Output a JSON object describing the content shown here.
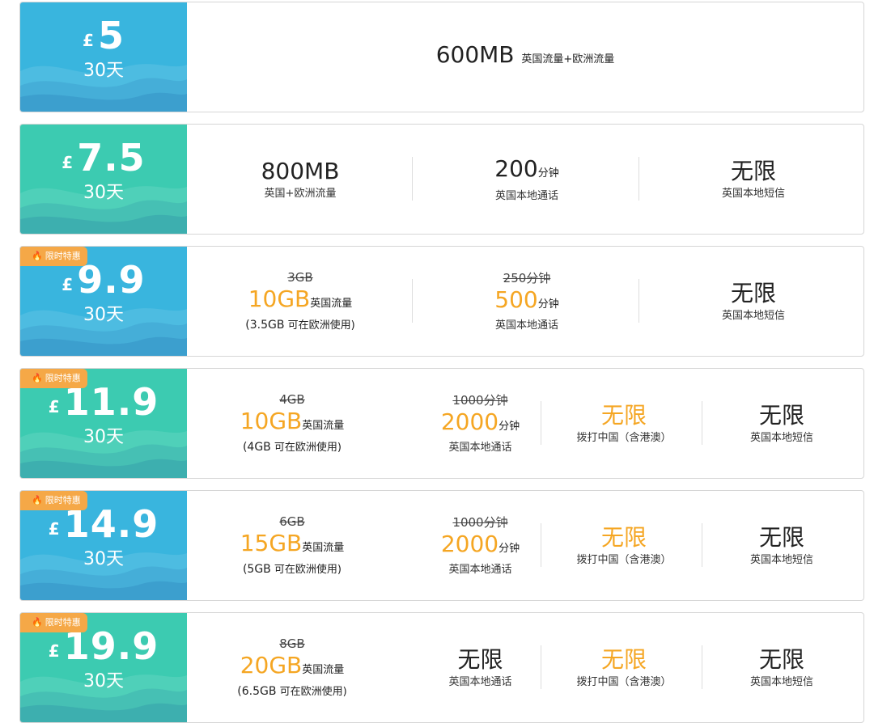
{
  "colors": {
    "blue": "#39b5de",
    "green": "#3ccbb1",
    "badge": "#f5a847",
    "highlight": "#f5a623"
  },
  "plans": [
    {
      "currency": "£",
      "amount": "5",
      "days": "30天",
      "badge": null,
      "data": {
        "value": "600MB",
        "desc": "英国流量+欧洲流量"
      }
    },
    {
      "currency": "£",
      "amount": "7.5",
      "days": "30天",
      "badge": null,
      "data": {
        "value": "800MB",
        "desc": "英国+欧洲流量"
      },
      "calls": {
        "value": "200",
        "unit": "分钟",
        "desc": "英国本地通话"
      },
      "sms": {
        "value": "无限",
        "desc": "英国本地短信"
      }
    },
    {
      "currency": "£",
      "amount": "9.9",
      "days": "30天",
      "badge": "限时特惠",
      "data": {
        "old": "3GB",
        "value": "10GB",
        "unit": "英国流量",
        "note_value": "(3.5GB",
        "note_text": " 可在欧洲使用)"
      },
      "calls": {
        "old": "250分钟",
        "value": "500",
        "unit": "分钟",
        "desc": "英国本地通话"
      },
      "sms": {
        "value": "无限",
        "desc": "英国本地短信"
      }
    },
    {
      "currency": "£",
      "amount": "11.9",
      "days": "30天",
      "badge": "限时特惠",
      "data": {
        "old": "4GB",
        "value": "10GB",
        "unit": "英国流量",
        "note_value": "(4GB",
        "note_text": " 可在欧洲使用)"
      },
      "calls": {
        "old": "1000分钟",
        "value": "2000",
        "unit": "分钟",
        "desc": "英国本地通话"
      },
      "intl": {
        "value": "无限",
        "desc": "拨打中国（含港澳）"
      },
      "sms": {
        "value": "无限",
        "desc": "英国本地短信"
      }
    },
    {
      "currency": "£",
      "amount": "14.9",
      "days": "30天",
      "badge": "限时特惠",
      "data": {
        "old": "6GB",
        "value": "15GB",
        "unit": "英国流量",
        "note_value": "(5GB",
        "note_text": " 可在欧洲使用)"
      },
      "calls": {
        "old": "1000分钟",
        "value": "2000",
        "unit": "分钟",
        "desc": "英国本地通话"
      },
      "intl": {
        "value": "无限",
        "desc": "拨打中国（含港澳）"
      },
      "sms": {
        "value": "无限",
        "desc": "英国本地短信"
      }
    },
    {
      "currency": "£",
      "amount": "19.9",
      "days": "30天",
      "badge": "限时特惠",
      "data": {
        "old": "8GB",
        "value": "20GB",
        "unit": "英国流量",
        "note_value": "(6.5GB",
        "note_text": " 可在欧洲使用)"
      },
      "calls": {
        "value": "无限",
        "desc": "英国本地通话"
      },
      "intl": {
        "value": "无限",
        "desc": "拨打中国（含港澳）"
      },
      "sms": {
        "value": "无限",
        "desc": "英国本地短信"
      }
    }
  ]
}
